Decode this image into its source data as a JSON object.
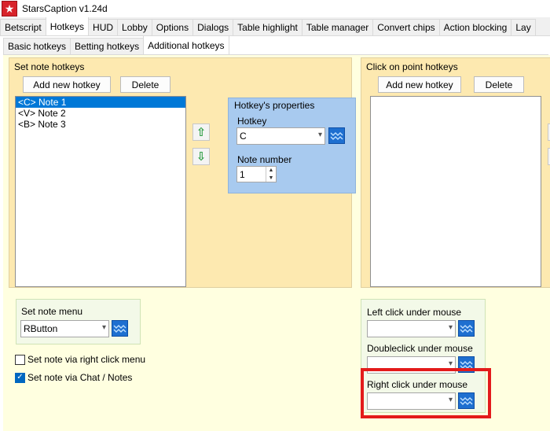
{
  "window": {
    "title": "StarsCaption v1.24d",
    "logo_glyph": "★"
  },
  "main_tabs": [
    "Betscript",
    "Hotkeys",
    "HUD",
    "Lobby",
    "Options",
    "Dialogs",
    "Table highlight",
    "Table manager",
    "Convert chips",
    "Action blocking",
    "Lay"
  ],
  "active_main_tab": "Hotkeys",
  "sub_tabs": [
    "Basic hotkeys",
    "Betting hotkeys",
    "Additional hotkeys"
  ],
  "active_sub_tab": "Additional hotkeys",
  "note_hotkeys": {
    "title": "Set note hotkeys",
    "add_label": "Add new hotkey",
    "delete_label": "Delete",
    "items": [
      "<C> Note 1",
      "<V> Note 2",
      "<B> Note 3"
    ],
    "selected_index": 0,
    "move_up_glyph": "⇧",
    "move_down_glyph": "⇩"
  },
  "properties": {
    "title": "Hotkey's properties",
    "hotkey_label": "Hotkey",
    "hotkey_value": "C",
    "note_number_label": "Note number",
    "note_number_value": "1"
  },
  "click_hotkeys": {
    "title": "Click on point hotkeys",
    "add_label": "Add new hotkey",
    "delete_label": "Delete"
  },
  "note_menu": {
    "title": "Set note menu",
    "value": "RButton",
    "right_click_menu_label": "Set note via right click menu",
    "right_click_menu_checked": false,
    "chat_notes_label": "Set note via Chat / Notes",
    "chat_notes_checked": true
  },
  "mouse": {
    "left_click_label": "Left click under mouse",
    "left_click_value": "",
    "double_click_label": "Doubleclick under mouse",
    "double_click_value": "",
    "right_click_label": "Right click under mouse",
    "right_click_value": ""
  },
  "colors": {
    "group_bg": "#fde9b0",
    "props_bg": "#a8caef",
    "selection": "#0078d7",
    "hotkey_button": "#1e6fd0",
    "highlight_box": "#e31b1b",
    "move_arrows": "#2f9e44"
  },
  "icons": {
    "hotkey_button": "keyboard-capture-icon",
    "dropdown": "chevron-down-icon",
    "move_up": "arrow-up-icon",
    "move_down": "arrow-down-icon"
  }
}
